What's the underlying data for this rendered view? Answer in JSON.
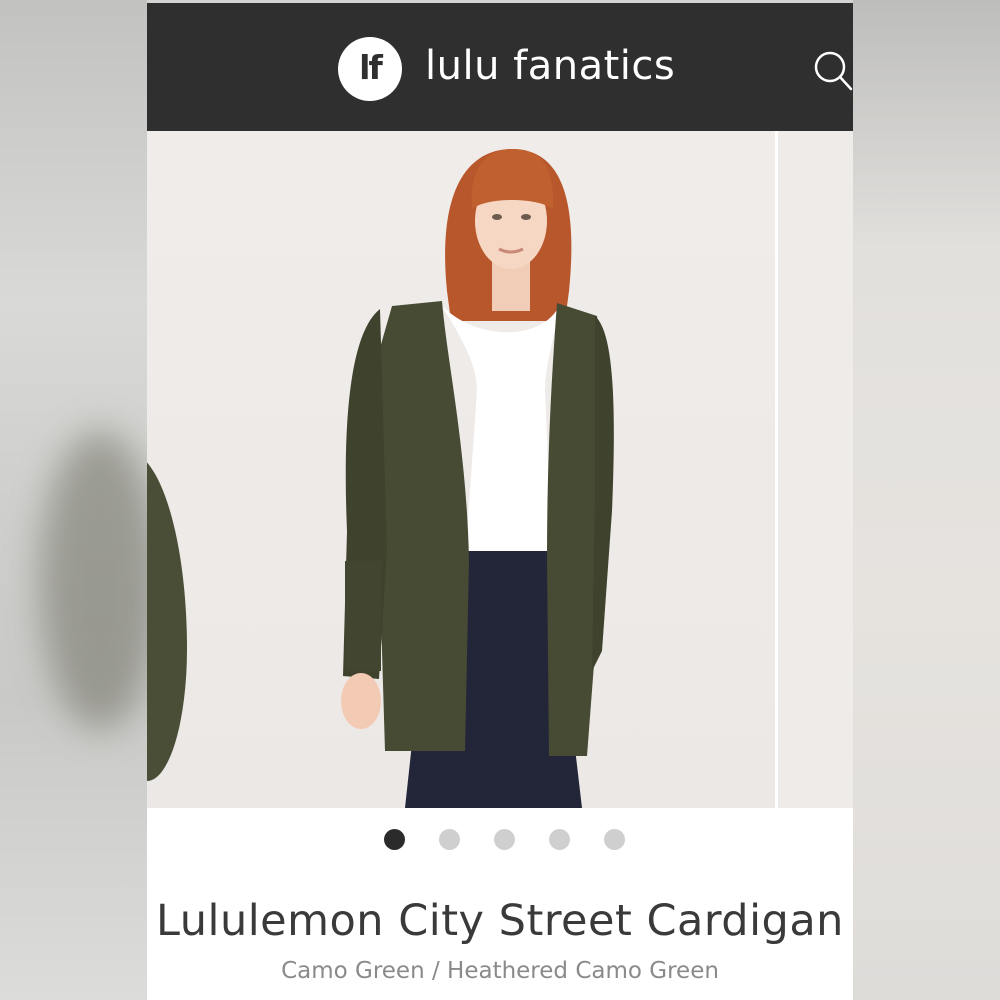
{
  "header": {
    "logo_mark": "lf",
    "brand_name": "lulu fanatics",
    "search_icon": "search-icon"
  },
  "carousel": {
    "slide_count": 5,
    "active_index": 0
  },
  "product": {
    "title": "Lululemon City Street Cardigan",
    "color": "Camo Green / Heathered Camo Green"
  },
  "colors": {
    "header_bg": "#2f2f2f",
    "dot_active": "#2b2b2b",
    "dot_inactive": "#cfcfcf",
    "cardigan": "#4a4e36"
  }
}
